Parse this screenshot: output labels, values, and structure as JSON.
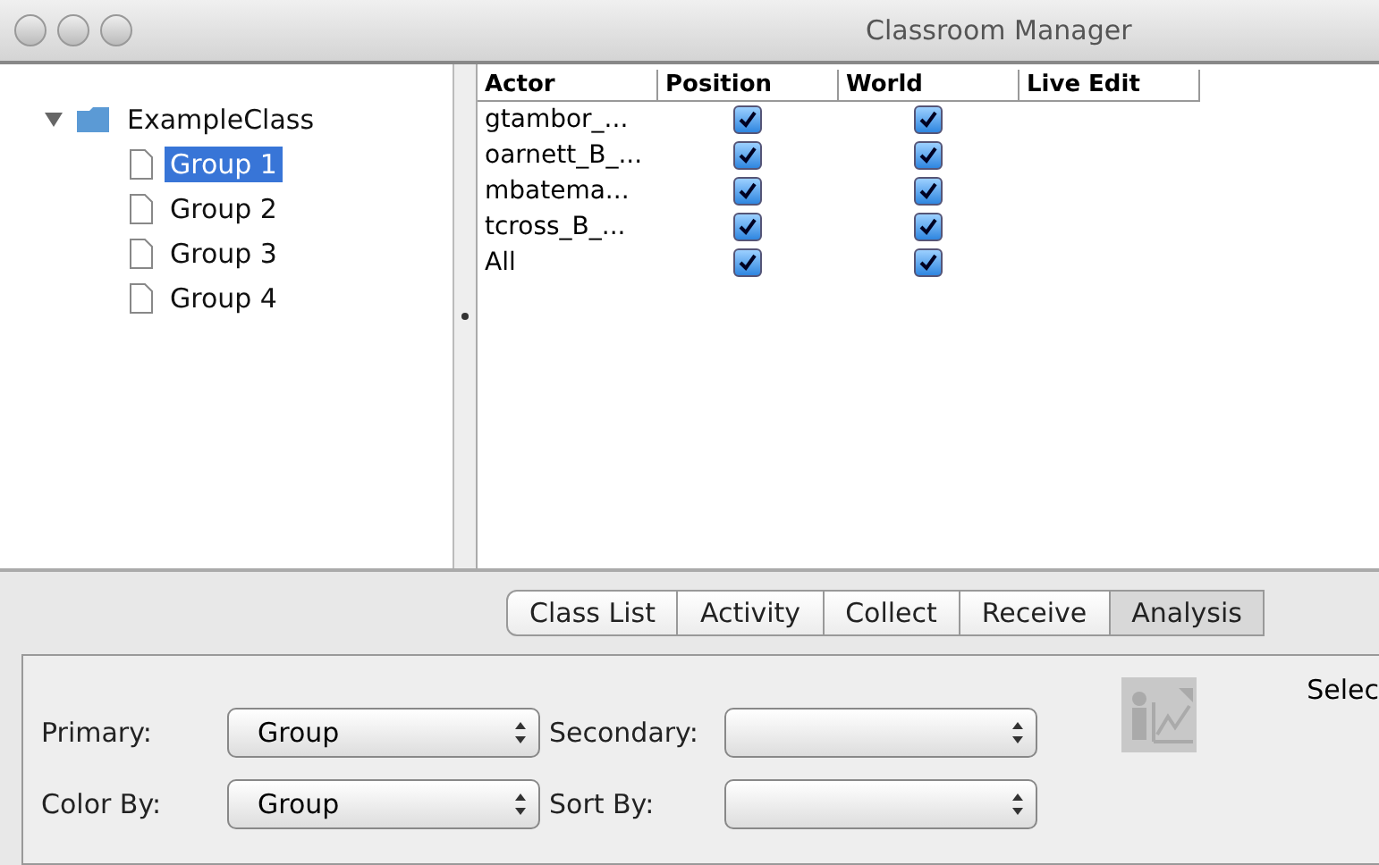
{
  "window": {
    "title": "Classroom Manager"
  },
  "tree": {
    "label": "ExampleClass",
    "expanded": true,
    "children": [
      {
        "label": "Group 1",
        "selected": true
      },
      {
        "label": "Group 2",
        "selected": false
      },
      {
        "label": "Group 3",
        "selected": false
      },
      {
        "label": "Group 4",
        "selected": false
      }
    ]
  },
  "table": {
    "columns": [
      "Actor",
      "Position",
      "World",
      "Live Edit"
    ],
    "rows": [
      {
        "actor": "gtambor_...",
        "position": true,
        "world": true
      },
      {
        "actor": "oarnett_B_...",
        "position": true,
        "world": true
      },
      {
        "actor": "mbatema...",
        "position": true,
        "world": true
      },
      {
        "actor": "tcross_B_...",
        "position": true,
        "world": true
      },
      {
        "actor": "All",
        "position": true,
        "world": true
      }
    ]
  },
  "tabs": [
    {
      "label": "Class List",
      "selected": false
    },
    {
      "label": "Activity",
      "selected": false
    },
    {
      "label": "Collect",
      "selected": false
    },
    {
      "label": "Receive",
      "selected": false
    },
    {
      "label": "Analysis",
      "selected": true
    }
  ],
  "analysis": {
    "fields": [
      {
        "label": "Primary:",
        "value": "Group"
      },
      {
        "label": "Secondary:"
      },
      {
        "label": "Color By:",
        "value": "Group"
      },
      {
        "label": "Sort By:"
      }
    ],
    "side_label": "Selec"
  }
}
